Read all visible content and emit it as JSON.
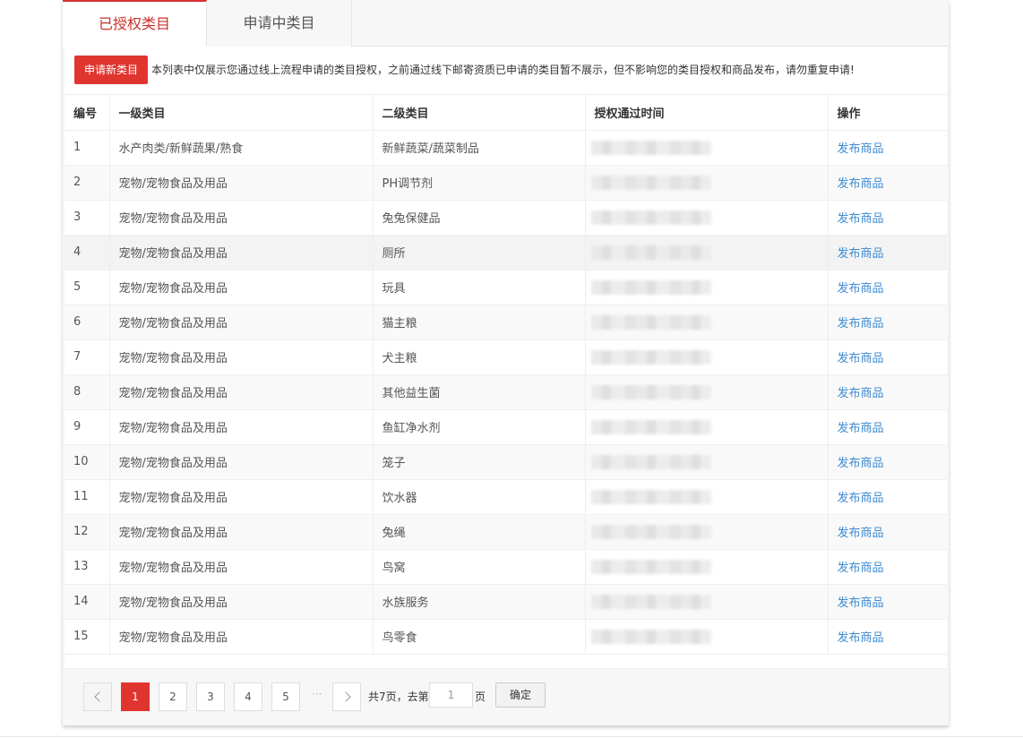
{
  "tabs": [
    {
      "label": "已授权类目",
      "active": true
    },
    {
      "label": "申请中类目",
      "active": false
    }
  ],
  "notice": {
    "button_label": "申请新类目",
    "text": "本列表中仅展示您通过线上流程申请的类目授权，之前通过线下邮寄资质已申请的类目暂不展示，但不影响您的类目授权和商品发布，请勿重复申请!"
  },
  "table": {
    "headers": [
      "编号",
      "一级类目",
      "二级类目",
      "授权通过时间",
      "操作"
    ],
    "rows": [
      {
        "id": "1",
        "level1": "水产肉类/新鲜蔬果/熟食",
        "level2": "新鲜蔬菜/蔬菜制品",
        "action": "发布商品"
      },
      {
        "id": "2",
        "level1": "宠物/宠物食品及用品",
        "level2": "PH调节剂",
        "action": "发布商品"
      },
      {
        "id": "3",
        "level1": "宠物/宠物食品及用品",
        "level2": "兔兔保健品",
        "action": "发布商品"
      },
      {
        "id": "4",
        "level1": "宠物/宠物食品及用品",
        "level2": "厕所",
        "action": "发布商品"
      },
      {
        "id": "5",
        "level1": "宠物/宠物食品及用品",
        "level2": "玩具",
        "action": "发布商品"
      },
      {
        "id": "6",
        "level1": "宠物/宠物食品及用品",
        "level2": "猫主粮",
        "action": "发布商品"
      },
      {
        "id": "7",
        "level1": "宠物/宠物食品及用品",
        "level2": "犬主粮",
        "action": "发布商品"
      },
      {
        "id": "8",
        "level1": "宠物/宠物食品及用品",
        "level2": "其他益生菌",
        "action": "发布商品"
      },
      {
        "id": "9",
        "level1": "宠物/宠物食品及用品",
        "level2": "鱼缸净水剂",
        "action": "发布商品"
      },
      {
        "id": "10",
        "level1": "宠物/宠物食品及用品",
        "level2": "笼子",
        "action": "发布商品"
      },
      {
        "id": "11",
        "level1": "宠物/宠物食品及用品",
        "level2": "饮水器",
        "action": "发布商品"
      },
      {
        "id": "12",
        "level1": "宠物/宠物食品及用品",
        "level2": "兔绳",
        "action": "发布商品"
      },
      {
        "id": "13",
        "level1": "宠物/宠物食品及用品",
        "level2": "鸟窝",
        "action": "发布商品"
      },
      {
        "id": "14",
        "level1": "宠物/宠物食品及用品",
        "level2": "水族服务",
        "action": "发布商品"
      },
      {
        "id": "15",
        "level1": "宠物/宠物食品及用品",
        "level2": "鸟零食",
        "action": "发布商品"
      }
    ]
  },
  "pagination": {
    "pages": [
      "1",
      "2",
      "3",
      "4",
      "5"
    ],
    "current": "1",
    "ellipsis": "···",
    "total_text": "共7页，去第",
    "goto_value": "1",
    "page_suffix": "页",
    "confirm_label": "确定"
  },
  "colors": {
    "accent": "#e0352f",
    "link": "#3e8bd1"
  }
}
